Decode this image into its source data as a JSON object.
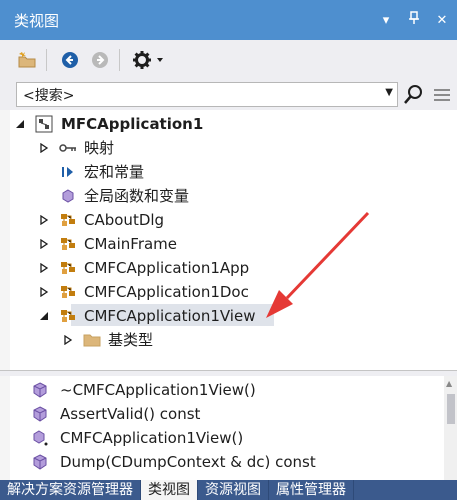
{
  "window": {
    "title": "类视图",
    "controls": {
      "menu": "▾",
      "pin": "⊥",
      "close": "✕"
    }
  },
  "toolbar": {
    "buttons": [
      "new-folder-icon",
      "back-icon",
      "forward-icon",
      "settings-icon"
    ]
  },
  "search": {
    "placeholder": "<搜索>",
    "value": "<搜索>"
  },
  "tree": {
    "root": {
      "label": "MFCApplication1",
      "expanded": true
    },
    "items": [
      {
        "label": "映射",
        "icon": "key-map-icon",
        "expandable": true
      },
      {
        "label": "宏和常量",
        "icon": "macro-icon",
        "expandable": false
      },
      {
        "label": "全局函数和变量",
        "icon": "global-icon",
        "expandable": false
      },
      {
        "label": "CAboutDlg",
        "icon": "class-icon",
        "expandable": true
      },
      {
        "label": "CMainFrame",
        "icon": "class-icon",
        "expandable": true
      },
      {
        "label": "CMFCApplication1App",
        "icon": "class-icon",
        "expandable": true
      },
      {
        "label": "CMFCApplication1Doc",
        "icon": "class-icon",
        "expandable": true
      },
      {
        "label": "CMFCApplication1View",
        "icon": "class-icon",
        "expandable": true,
        "expanded": true,
        "selected": true
      },
      {
        "label": "基类型",
        "icon": "folder-icon",
        "expandable": true
      }
    ]
  },
  "members": [
    {
      "label": "~CMFCApplication1View()",
      "icon": "method-icon"
    },
    {
      "label": "AssertValid() const",
      "icon": "method-icon"
    },
    {
      "label": "CMFCApplication1View()",
      "icon": "protected-method-icon"
    },
    {
      "label": "Dump(CDumpContext & dc) const",
      "icon": "method-icon"
    }
  ],
  "tabs": [
    {
      "label": "解决方案资源管理器",
      "active": false
    },
    {
      "label": "类视图",
      "active": true
    },
    {
      "label": "资源视图",
      "active": false
    },
    {
      "label": "属性管理器",
      "active": false
    }
  ],
  "colors": {
    "title_bar": "#4e8fcf",
    "tab_bar": "#3b5a8d",
    "class_icon": "#c27d0e",
    "annotation_arrow": "#e53935"
  }
}
